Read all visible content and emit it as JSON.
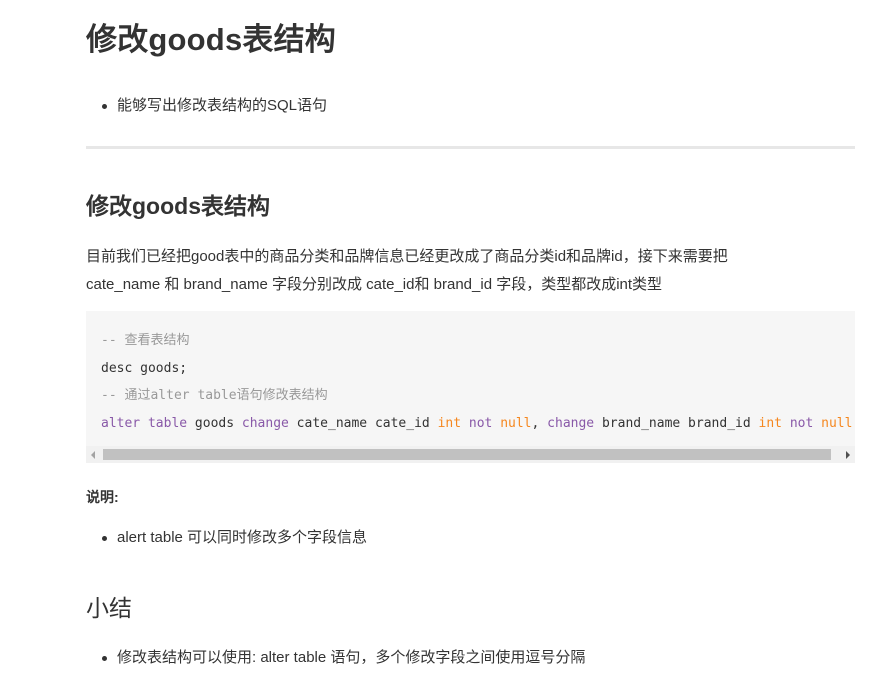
{
  "page_title": "修改goods表结构",
  "goals": [
    "能够写出修改表结构的SQL语句"
  ],
  "section": {
    "heading": "修改goods表结构",
    "paragraph_line1": "目前我们已经把good表中的商品分类和品牌信息已经更改成了商品分类id和品牌id，接下来需要把",
    "paragraph_line2": "cate_name 和 brand_name 字段分别改成 cate_id和 brand_id 字段，类型都改成int类型",
    "code": {
      "line1": "-- 查看表结构",
      "line2": "desc goods;",
      "line3": "-- 通过alter table语句修改表结构",
      "line4": {
        "kw1": "alter table",
        "t1": " goods ",
        "kw2": "change",
        "t2": " cate_name cate_id ",
        "type1": "int",
        "sp1": " ",
        "kw3": "not",
        "sp2": " ",
        "type2": "null",
        "t3": ", ",
        "kw4": "change",
        "t4": " brand_name brand_id ",
        "type3": "int",
        "sp3": " ",
        "kw5": "not",
        "sp4": " ",
        "type4": "null",
        "t5": ";"
      }
    },
    "note_label": "说明:",
    "notes": [
      "alert table 可以同时修改多个字段信息"
    ]
  },
  "summary": {
    "heading": "小结",
    "items": [
      "修改表结构可以使用: alter table 语句，多个修改字段之间使用逗号分隔"
    ]
  }
}
